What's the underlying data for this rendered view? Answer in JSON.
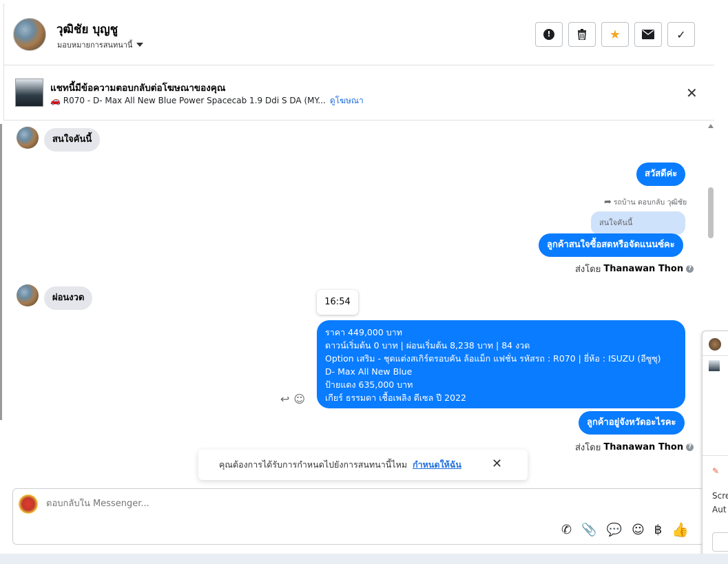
{
  "header": {
    "contact_name": "วุฒิชัย บุญชู",
    "assign_label": "มอบหมายการสนทนานี้",
    "buttons": [
      {
        "name": "report-button",
        "icon": "!"
      },
      {
        "name": "delete-button",
        "icon": "🗑"
      },
      {
        "name": "star-button",
        "icon": "★"
      },
      {
        "name": "mark-unread-button",
        "icon": "✉"
      },
      {
        "name": "mark-done-button",
        "icon": "✓"
      }
    ]
  },
  "ad": {
    "title": "แชทนี้มีข้อความตอบกลับต่อโฆษณาของคุณ",
    "subtitle": "🚗 R070 - D- Max All New Blue Power Spacecab 1.9 Ddi S DA (MY...",
    "link": "ดูโฆษณา",
    "close": "✕"
  },
  "messages": {
    "in_1": "สนใจคันนี้",
    "out_1": "สวัสดีค่ะ",
    "reply_note": "รถบ้าน ตอบกลับ วุฒิชัย",
    "quoted": "สนใจคันนี้",
    "out_2": "ลูกค้าสนใจซื้อสดหรือจัดแนนซ์คะ",
    "sent_by_prefix": "ส่งโดย",
    "sent_by_name": "Thanawan Thon",
    "in_2": "ผ่อนงวด",
    "time_tooltip": "16:54",
    "long_lines": [
      "ราคา 449,000 บาท",
      "ดาวน์เริ่มต้น 0 บาท | ผ่อนเริ่มต้น 8,238 บาท | 84 งวด",
      " Option เสริม - ชุดแต่งสเกิร์ตรอบคัน ล้อแม็ก แฟชั่น  รหัสรถ : R070 |  ยี่ห้อ : ISUZU (อีซูซุ)",
      "D- Max All New Blue",
      " ป้ายแดง 635,000 บาท",
      " เกียร์ ธรรมดา  เชื้อเพลิง ดีเซล  ปี 2022"
    ],
    "out_3": "ลูกค้าอยู่จังหวัดอะไรคะ",
    "sent_by_prefix_2": "ส่งโดย",
    "sent_by_name_2": "Thanawan Thon"
  },
  "toast": {
    "text": "คุณต้องการได้รับการกำหนดไปยังการสนทนานี้ไหม",
    "link": "กำหนดให้ฉัน",
    "close": "✕"
  },
  "composer": {
    "placeholder": "ตอบกลับใน Messenger..."
  },
  "side_panel": {
    "text1": "Scre",
    "text2": "Aut"
  },
  "colors": {
    "accent": "#0a7cff",
    "star": "#f5a623",
    "link": "#216fdb"
  }
}
